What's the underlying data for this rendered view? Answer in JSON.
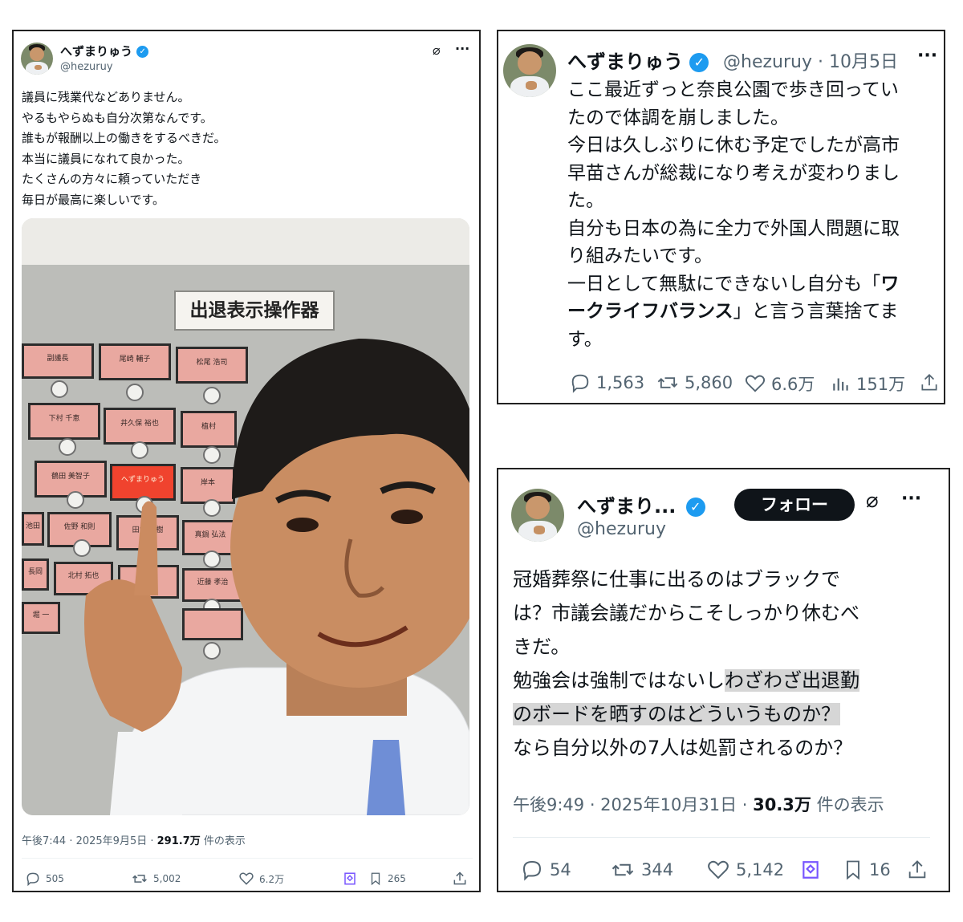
{
  "tweet1": {
    "name": "へずまりゅう",
    "handle": "@hezuruy",
    "lines": [
      "議員に残業代などありません。",
      "やるもやらぬも自分次第なんです。",
      "誰もが報酬以上の働きをするべきだ。",
      "本当に議員になれて良かった。",
      "たくさんの方々に頼っていただき",
      "毎日が最高に楽しいです。"
    ],
    "photo": {
      "sign": "出退表示操作器",
      "plates": [
        "副議長",
        "尾崎 輔子",
        "松尾 浩司",
        "下村 千恵",
        "井久保 裕也",
        "植村",
        "鶴田 美智子",
        "へずまりゅう",
        "岸本",
        "池田",
        "佐野 和則",
        "田中 浩樹",
        "真鍋 弘法",
        "長岡",
        "北村 拓也",
        "辻",
        "近藤 孝治",
        "堀 一"
      ]
    },
    "meta_time": "午後7:44 · 2025年9月5日 · ",
    "meta_views": "291.7万",
    "meta_suffix": " 件の表示",
    "replies": "505",
    "retweets": "5,002",
    "likes": "6.2万",
    "bookmarks": "265"
  },
  "tweet2": {
    "name": "へずまりゅう",
    "handle": "@hezuruy",
    "date": "· 10月5日",
    "lines": [
      "ここ最近ずっと奈良公園で歩き回ってい",
      "たので体調を崩しました。",
      "今日は久しぶりに休む予定でしたが高市",
      "早苗さんが総裁になり考えが変わりまし",
      "た。",
      "自分も日本の為に全力で外国人問題に取",
      "り組みたいです。"
    ],
    "line8_pre": "一日として無駄にできないし自分も「",
    "line8_bold": "ワ",
    "line9_bold": "ークライフバランス",
    "line9_post": "」と言う言葉捨てま",
    "line10": "す。",
    "replies": "1,563",
    "retweets": "5,860",
    "likes": "6.6万",
    "views": "151万"
  },
  "tweet3": {
    "name": "へずまり...",
    "handle": "@hezuruy",
    "follow": "フォロー",
    "lines": [
      "冠婚葬祭に仕事に出るのはブラックで",
      "は？市議会議だからこそしっかり休むべ",
      "きだ。"
    ],
    "line4_pre": "勉強会は強制ではないし",
    "line4_hl": "わざわざ出退勤",
    "line5_hl": "のボードを晒すのはどういうものか？",
    "line6": "なら自分以外の7人は処罰されるのか？",
    "meta_time": "午後9:49 · 2025年10月31日 · ",
    "meta_views": "30.3万",
    "meta_suffix": " 件の表示",
    "replies": "54",
    "retweets": "344",
    "likes": "5,142",
    "bookmarks": "16"
  },
  "colors": {
    "text": "#0f1419",
    "muted": "#536471",
    "verified": "#1d9bf0",
    "grok": "#7856ff",
    "highlight": "#d6d6d6"
  }
}
